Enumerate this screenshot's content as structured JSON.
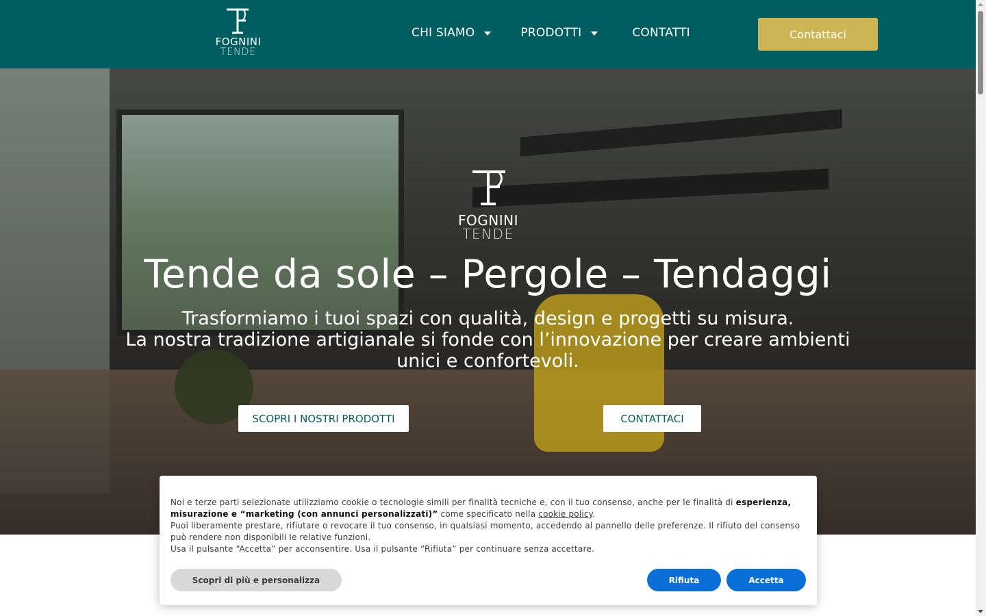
{
  "header": {
    "logo": {
      "brand": "FOGNINI",
      "sub": "TENDE"
    },
    "nav": [
      {
        "label": "CHI SIAMO",
        "has_dropdown": true
      },
      {
        "label": "PRODOTTI",
        "has_dropdown": true
      },
      {
        "label": "CONTATTI",
        "has_dropdown": false
      }
    ],
    "cta_label": "Contattaci"
  },
  "hero": {
    "logo": {
      "brand": "FOGNINI",
      "sub": "TENDE"
    },
    "title": "Tende da sole – Pergole – Tendaggi",
    "subtitle_line1": "Trasformiamo i tuoi spazi con qualità, design e progetti su misura.",
    "subtitle_line2": "La nostra tradizione artigianale si fonde con l’innovazione per creare ambienti unici e confortevoli.",
    "btn_products": "SCOPRI I NOSTRI PRODOTTI",
    "btn_contact": "CONTATTACI"
  },
  "cookie": {
    "p1_a": "Noi e terze parti selezionate utilizziamo cookie o tecnologie simili per finalità tecniche e, con il tuo consenso, anche per le finalità di ",
    "p1_bold": "esperienza, misurazione e “marketing (con annunci personalizzati)”",
    "p1_b": " come specificato nella ",
    "p1_link": "cookie policy",
    "p1_c": ".",
    "p2": "Puoi liberamente prestare, rifiutare o revocare il tuo consenso, in qualsiasi momento, accedendo al pannello delle preferenze. Il rifiuto del consenso può rendere non disponibili le relative funzioni.",
    "p3": "Usa il pulsante “Accetta” per acconsentire. Usa il pulsante “Rifiuta” per continuare senza accettare.",
    "btn_preferences": "Scopri di più e personalizza",
    "btn_reject": "Rifiuta",
    "btn_accept": "Accetta"
  },
  "colors": {
    "header_bg": "#015e60",
    "cta_gold": "#cdb454",
    "cookie_blue": "#0a6fd6"
  }
}
